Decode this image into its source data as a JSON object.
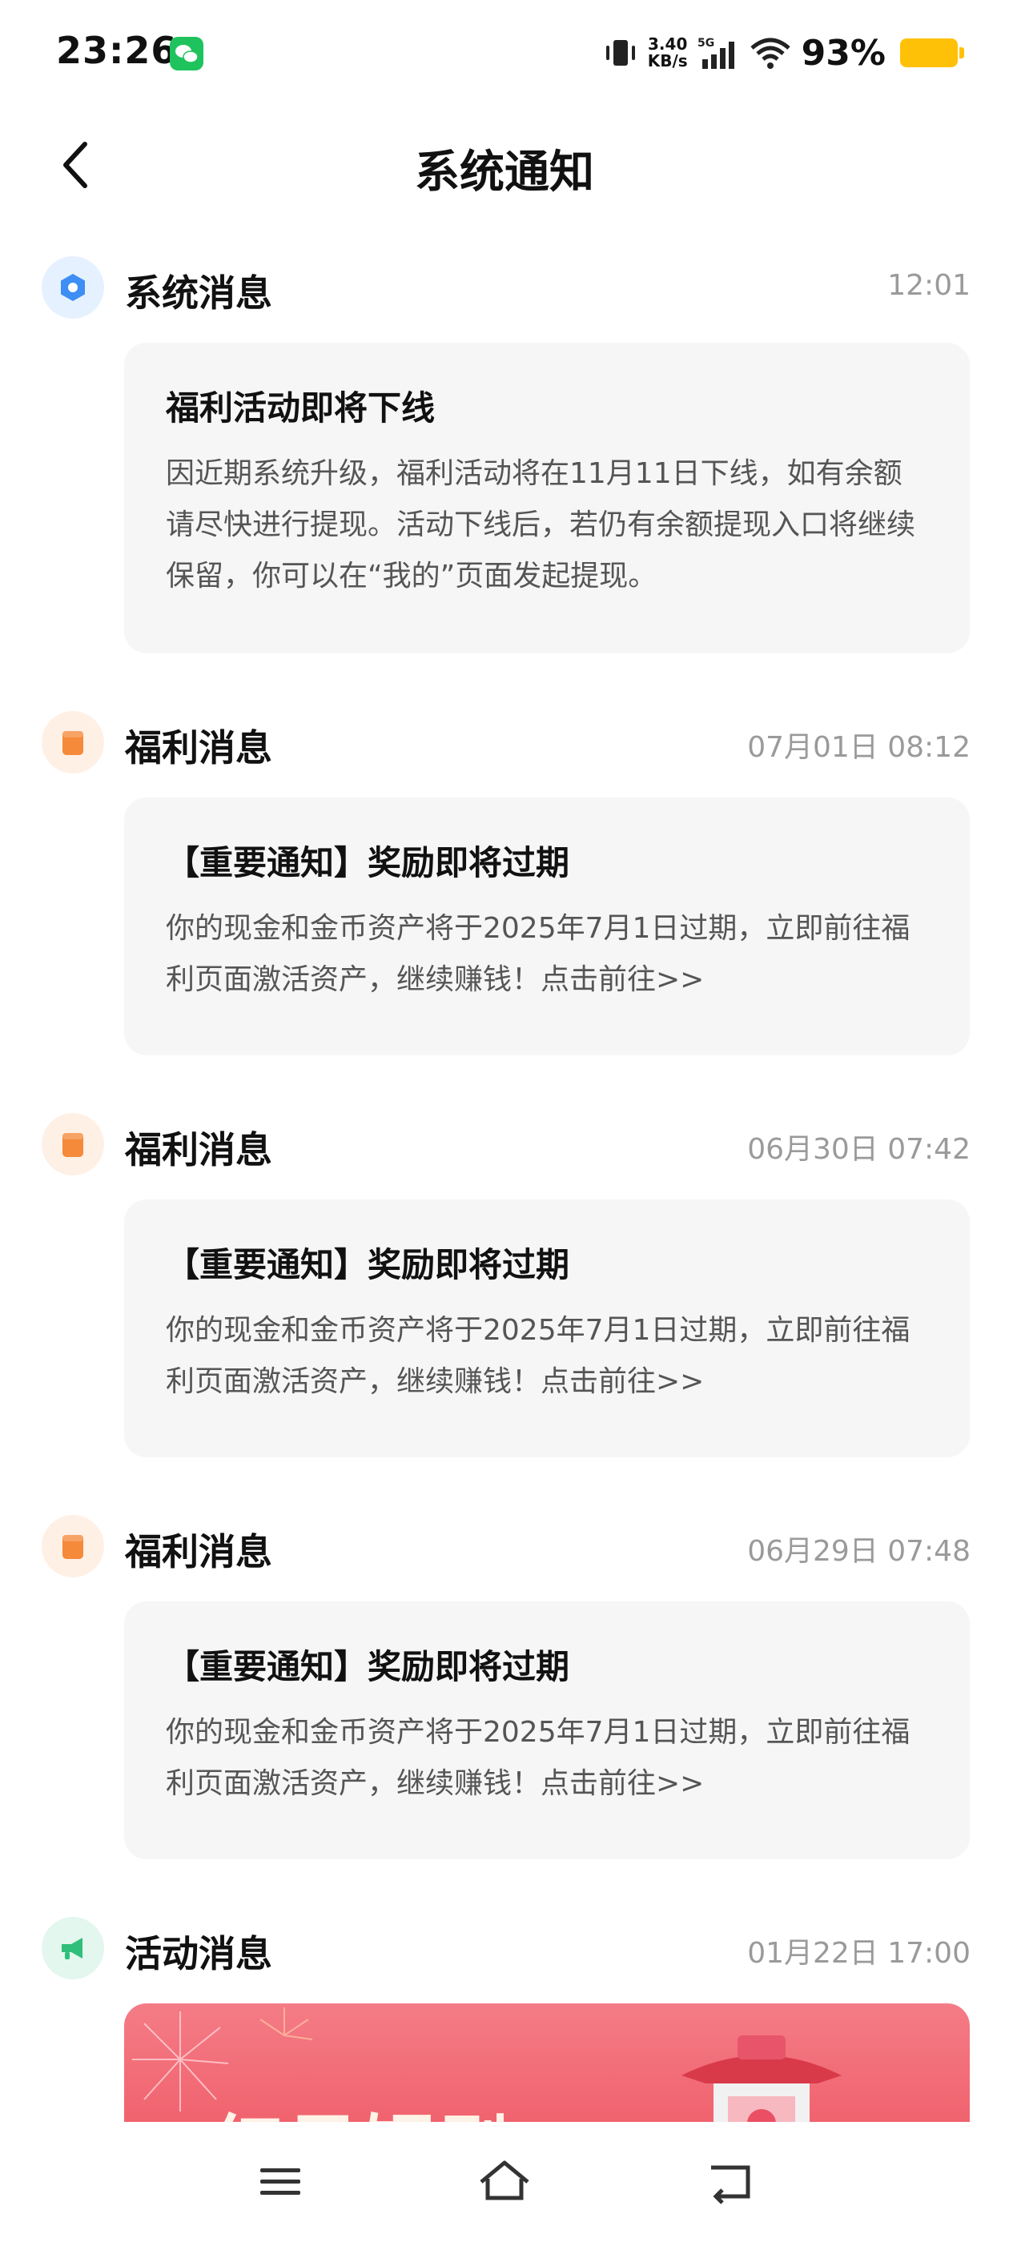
{
  "status_bar": {
    "time": "23:26",
    "net_speed_value": "3.40",
    "net_speed_unit": "KB/s",
    "network": "5G",
    "battery_pct": "93%",
    "battery_color": "#ffc107"
  },
  "header": {
    "title": "系统通知",
    "back_icon": "chevron-left-icon"
  },
  "messages": [
    {
      "type": "系统消息",
      "icon": "system-gear-icon",
      "time": "12:01",
      "title": "福利活动即将下线",
      "body": "因近期系统升级，福利活动将在11月11日下线，如有余额请尽快进行提现。活动下线后，若仍有余额提现入口将继续保留，你可以在“我的”页面发起提现。"
    },
    {
      "type": "福利消息",
      "icon": "welfare-icon",
      "time": "07月01日 08:12",
      "title": "【重要通知】奖励即将过期",
      "body": "你的现金和金币资产将于2025年7月1日过期，立即前往福利页面激活资产，继续赚钱！点击前往>>"
    },
    {
      "type": "福利消息",
      "icon": "welfare-icon",
      "time": "06月30日 07:42",
      "title": "【重要通知】奖励即将过期",
      "body": "你的现金和金币资产将于2025年7月1日过期，立即前往福利页面激活资产，继续赚钱！点击前往>>"
    },
    {
      "type": "福利消息",
      "icon": "welfare-icon",
      "time": "06月29日 07:48",
      "title": "【重要通知】奖励即将过期",
      "body": "你的现金和金币资产将于2025年7月1日过期，立即前往福利页面激活资产，继续赚钱！点击前往>>"
    },
    {
      "type": "活动消息",
      "icon": "megaphone-icon",
      "time": "01月22日 17:00",
      "banner_text": "红果短剧"
    }
  ],
  "colors": {
    "system_accent": "#3d8ef5",
    "welfare_accent": "#f58a3a",
    "activity_accent": "#2fbf7a"
  },
  "bottom_nav": {
    "items": [
      "menu-icon",
      "home-icon",
      "back-icon"
    ]
  }
}
